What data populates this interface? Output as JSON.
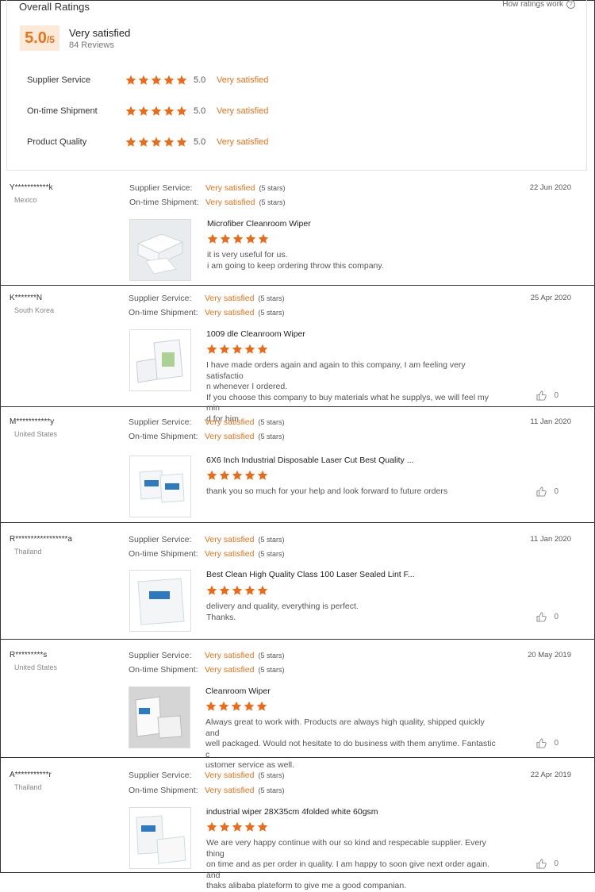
{
  "summary": {
    "title": "Overall Ratings",
    "how_link": "How ratings work",
    "score": "5.0",
    "score_max": "/5",
    "label": "Very satisfied",
    "reviews": "84 Reviews",
    "rows": [
      {
        "label": "Supplier Service",
        "value": "5.0",
        "text": "Very satisfied",
        "stars": 5
      },
      {
        "label": "On-time Shipment",
        "value": "5.0",
        "text": "Very satisfied",
        "stars": 5
      },
      {
        "label": "Product Quality",
        "value": "5.0",
        "text": "Very satisfied",
        "stars": 5
      }
    ]
  },
  "reviews": [
    {
      "name": "Y***********k",
      "country": "Mexico",
      "date": "22 Jun 2020",
      "service_label": "Supplier Service:",
      "service_value": "Very satisfied",
      "service_stars": "(5 stars)",
      "shipment_label": "On-time Shipment:",
      "shipment_value": "Very satisfied",
      "shipment_stars": "(5 stars)",
      "product": "Microfiber Cleanroom Wiper",
      "text_lines": [
        "it is very useful for us.",
        "i am going to keep ordering throw this company."
      ],
      "likes": ""
    },
    {
      "name": "K*******N",
      "country": "South Korea",
      "date": "25 Apr 2020",
      "service_label": "Supplier Service:",
      "service_value": "Very satisfied",
      "service_stars": "(5 stars)",
      "shipment_label": "On-time Shipment:",
      "shipment_value": "Very satisfied",
      "shipment_stars": "(5 stars)",
      "product": "1009 dle Cleanroom Wiper",
      "text_lines": [
        "I have made orders again and again to this company, I am feeling very satisfactio",
        "n whenever I ordered.",
        "If you choose this company to buy materials what he supplys, we will feel my min",
        "d for him."
      ],
      "likes": "0"
    },
    {
      "name": "M***********y",
      "country": "United States",
      "date": "11 Jan 2020",
      "service_label": "Supplier Service:",
      "service_value": "Very satisfied",
      "service_stars": "(5 stars)",
      "shipment_label": "On-time Shipment:",
      "shipment_value": "Very satisfied",
      "shipment_stars": "(5 stars)",
      "product": "6X6 Inch Industrial Disposable Laser Cut Best Quality ...",
      "text_lines": [
        "thank you so much for your help and look forward to future orders"
      ],
      "likes": "0"
    },
    {
      "name": "R*****************a",
      "country": "Thailand",
      "date": "11 Jan 2020",
      "service_label": "Supplier Service:",
      "service_value": "Very satisfied",
      "service_stars": "(5 stars)",
      "shipment_label": "On-time Shipment:",
      "shipment_value": "Very satisfied",
      "shipment_stars": "(5 stars)",
      "product": "Best Clean High Quality Class 100 Laser Sealed Lint F...",
      "text_lines": [
        "delivery and quality, everything is perfect.",
        "Thanks."
      ],
      "likes": "0"
    },
    {
      "name": "R*********s",
      "country": "United States",
      "date": "20 May 2019",
      "service_label": "Supplier Service:",
      "service_value": "Very satisfied",
      "service_stars": "(5 stars)",
      "shipment_label": "On-time Shipment:",
      "shipment_value": "Very satisfied",
      "shipment_stars": "(5 stars)",
      "product": "Cleanroom Wiper",
      "text_lines": [
        "Always great to work with. Products are always high quality, shipped quickly and",
        "well packaged. Would not hesitate to do business with them anytime. Fantastic c",
        "ustomer service as well."
      ],
      "likes": "0"
    },
    {
      "name": "A***********r",
      "country": "Thailand",
      "date": "22 Apr 2019",
      "service_label": "Supplier Service:",
      "service_value": "Very satisfied",
      "service_stars": "(5 stars)",
      "shipment_label": "On-time Shipment:",
      "shipment_value": "Very satisfied",
      "shipment_stars": "(5 stars)",
      "product": "industrial wiper 28X35cm 4folded white 60gsm",
      "text_lines": [
        "We are very happy continue with our so kind and respecable supplier. Every thing",
        "on time and as per order in quality. I am happy to soon give next order again. and",
        "thaks alibaba plateform to give me a good companian."
      ],
      "likes": "0"
    }
  ]
}
